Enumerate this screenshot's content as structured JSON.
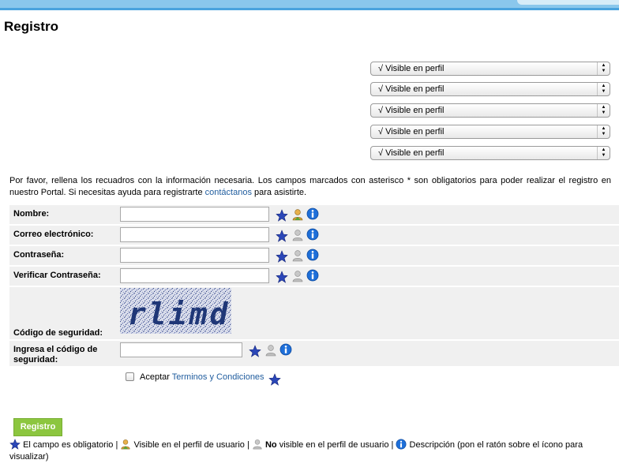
{
  "page": {
    "title": "Registro"
  },
  "privacy_selects": [
    {
      "value": "√ Visible en perfil"
    },
    {
      "value": "√ Visible en perfil"
    },
    {
      "value": "√ Visible en perfil"
    },
    {
      "value": "√ Visible en perfil"
    },
    {
      "value": "√ Visible en perfil"
    }
  ],
  "intro": {
    "text_before": "Por favor, rellena los recuadros con la información necesaria. Los campos marcados con asterisco * son obligatorios para poder realizar el registro en nuestro Portal. Si necesitas ayuda para registrarte ",
    "link": "contáctanos",
    "text_after": " para asistirte."
  },
  "form": {
    "fields": [
      {
        "label": "Nombre:",
        "profile_visible": true
      },
      {
        "label": "Correo electrónico:",
        "profile_visible": false
      },
      {
        "label": "Contraseña:",
        "profile_visible": false
      },
      {
        "label": "Verificar Contraseña:",
        "profile_visible": false
      }
    ],
    "captcha_label": "Código de seguridad:",
    "captcha_text": "rlimd",
    "captcha_input_label": "Ingresa el código de seguridad:",
    "accept_label": "Aceptar",
    "terms_link": "Terminos y Condiciones",
    "submit_label": "Registro"
  },
  "legend": {
    "required": "El campo es obligatorio",
    "visible": "Visible en el perfil de usuario",
    "not_visible_bold": "No",
    "not_visible": "visible en el perfil de usuario",
    "description": "Descripción (pon el ratón sobre el ícono para visualizar)"
  },
  "colors": {
    "accent_blue": "#4aa3dd",
    "button_green": "#8cc63f",
    "link": "#1f5c9e",
    "star": "#2b47b8",
    "info": "#1e6fd9"
  },
  "icons": {
    "required": "star-icon",
    "visible": "user-visible-icon",
    "hidden": "user-hidden-icon",
    "info": "info-icon"
  }
}
